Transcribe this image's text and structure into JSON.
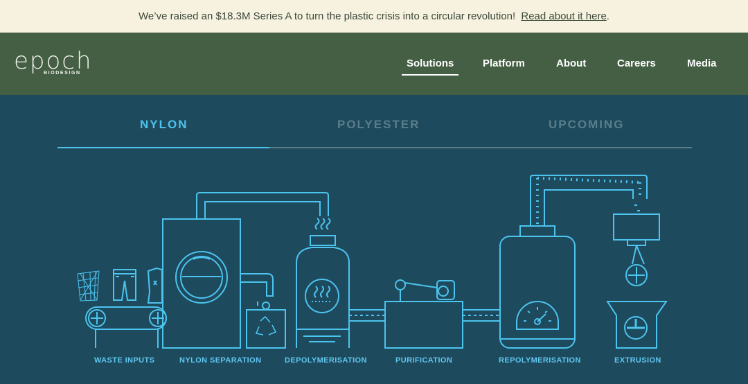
{
  "banner": {
    "message": "We’ve raised an $18.3M Series A to turn the plastic crisis into a circular revolution! ",
    "link_label": "Read about it here",
    "trailing": "."
  },
  "logo": {
    "wordmark": "epoch",
    "sub": "BIODESIGN"
  },
  "nav": {
    "items": [
      {
        "label": "Solutions",
        "active": true
      },
      {
        "label": "Platform"
      },
      {
        "label": "About"
      },
      {
        "label": "Careers"
      },
      {
        "label": "Media"
      }
    ]
  },
  "tabs": [
    {
      "label": "NYLON",
      "active": true
    },
    {
      "label": "POLYESTER"
    },
    {
      "label": "UPCOMING"
    }
  ],
  "stages": [
    "WASTE INPUTS",
    "NYLON SEPARATION",
    "DEPOLYMERISATION",
    "PURIFICATION",
    "REPOLYMERISATION",
    "EXTRUSION"
  ],
  "colors": {
    "banner_bg": "#f7f1df",
    "nav_bg": "#445f43",
    "main_bg": "#1e4a5e",
    "accent": "#4cc4ee",
    "inactive": "#5a7d8a"
  }
}
